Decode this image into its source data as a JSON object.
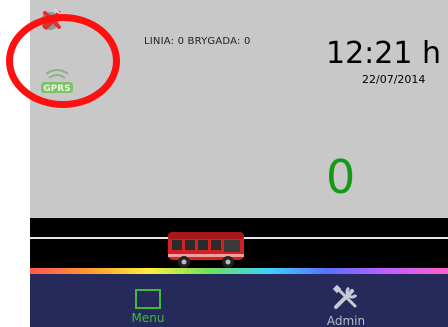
{
  "header": {
    "linia_label": "LINIA:",
    "linia_value": "0",
    "brygada_label": "BRYGADA:",
    "brygada_value": "0",
    "time": "12:21 h",
    "date": "22/07/2014"
  },
  "status": {
    "gps_icon_text": "GPRS"
  },
  "counter": {
    "value": "0"
  },
  "bottom_bar": {
    "menu_label": "Menu",
    "admin_label": "Admin"
  },
  "colors": {
    "screen_bg": "#c8c8c8",
    "counter": "#159a17",
    "bottom_bar": "#262a5a",
    "menu_accent": "#3fbb3a",
    "highlight": "#ff1010",
    "bus": "#d42020"
  },
  "icons": {
    "gps_off": "gps-off-icon",
    "gps": "gps-signal-icon",
    "menu": "menu-square-icon",
    "admin": "tools-icon",
    "bus": "bus-icon"
  }
}
